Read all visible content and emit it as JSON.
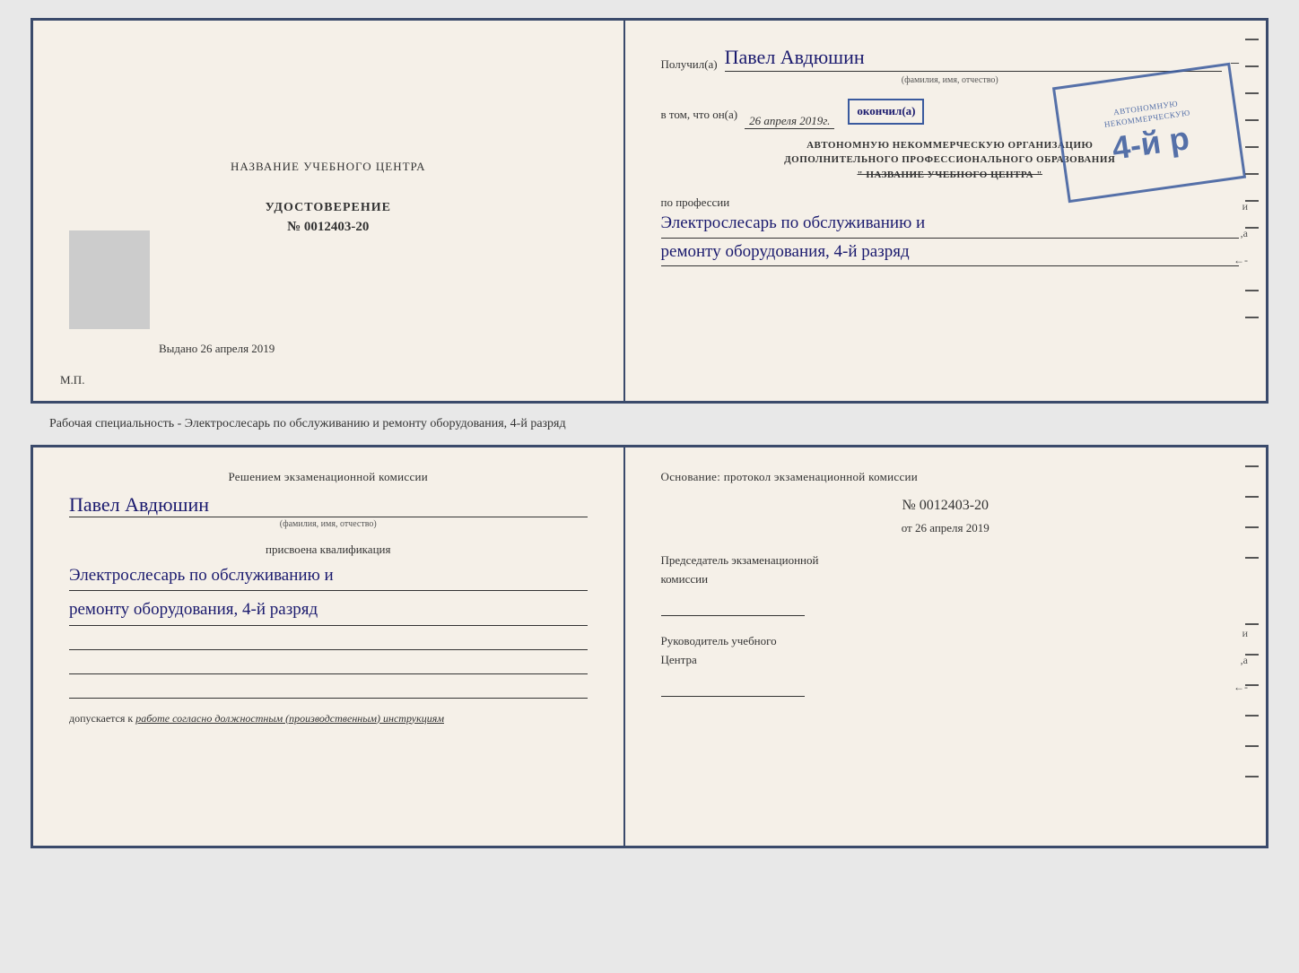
{
  "top_doc": {
    "left": {
      "title": "НАЗВАНИЕ УЧЕБНОГО ЦЕНТРА",
      "udostoverenie": "УДОСТОВЕРЕНИЕ",
      "number_label": "№",
      "number": "0012403-20",
      "vydano_label": "Выдано",
      "vydano_date": "26 апреля 2019",
      "mp_label": "М.П."
    },
    "right": {
      "poluchil_label": "Получил(а)",
      "name": "Павел Авдюшин",
      "fio_subtitle": "(фамилия, имя, отчество)",
      "vtom_label": "в том, что он(а)",
      "vtom_date": "26 апреля 2019г.",
      "okonchil_label": "окончил(а)",
      "org_line1": "АВТОНОМНУЮ НЕКОММЕРЧЕСКУЮ ОРГАНИЗАЦИЮ",
      "org_line2": "ДОПОЛНИТЕЛЬНОГО ПРОФЕССИОНАЛЬНОГО ОБРАЗОВАНИЯ",
      "org_name": "\" НАЗВАНИЕ УЧЕБНОГО ЦЕНТРА \"",
      "po_professii": "по профессии",
      "profession_line1": "Электрослесарь по обслуживанию и",
      "profession_line2": "ремонту оборудования, 4-й разряд",
      "stamp_big": "4-й р",
      "stamp_top": "АВТОНОМНУЮ НЕКОММЕРЧЕСКУЮ"
    }
  },
  "between": {
    "text": "Рабочая специальность - Электрослесарь по обслуживанию и ремонту оборудования, 4-й разряд"
  },
  "bottom_doc": {
    "left": {
      "resheniyem_title": "Решением экзаменационной комиссии",
      "name": "Павел Авдюшин",
      "fio_subtitle": "(фамилия, имя, отчество)",
      "prisvoena": "присвоена квалификация",
      "qual_line1": "Электрослесарь по обслуживанию и",
      "qual_line2": "ремонту оборудования, 4-й разряд",
      "dopuskaetsya_prefix": "допускается к",
      "dopuskaetsya_text": "работе согласно должностным (производственным) инструкциям"
    },
    "right": {
      "osnovanie": "Основание: протокол экзаменационной комиссии",
      "number": "№  0012403-20",
      "ot_prefix": "от",
      "ot_date": "26 апреля 2019",
      "predsedatel_line1": "Председатель экзаменационной",
      "predsedatel_line2": "комиссии",
      "rukovoditel_line1": "Руководитель учебного",
      "rukovoditel_line2": "Центра"
    }
  },
  "decorative": {
    "right_dashes_count": 10
  }
}
